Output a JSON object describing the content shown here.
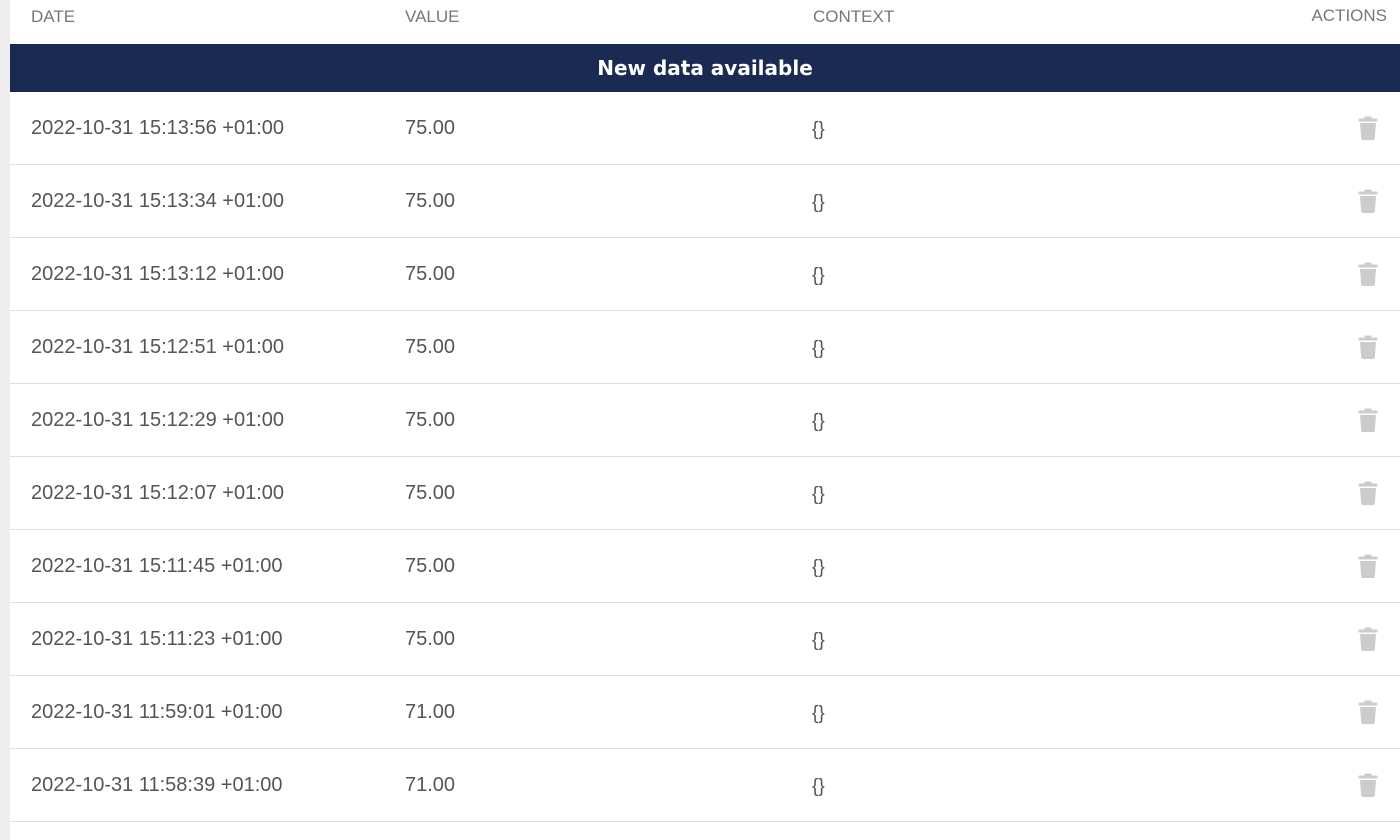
{
  "table": {
    "headers": {
      "date": "DATE",
      "value": "VALUE",
      "context": "CONTEXT",
      "actions": "ACTIONS"
    },
    "banner": "New data available",
    "rows": [
      {
        "date": "2022-10-31 15:13:56 +01:00",
        "value": "75.00",
        "context": "{}"
      },
      {
        "date": "2022-10-31 15:13:34 +01:00",
        "value": "75.00",
        "context": "{}"
      },
      {
        "date": "2022-10-31 15:13:12 +01:00",
        "value": "75.00",
        "context": "{}"
      },
      {
        "date": "2022-10-31 15:12:51 +01:00",
        "value": "75.00",
        "context": "{}"
      },
      {
        "date": "2022-10-31 15:12:29 +01:00",
        "value": "75.00",
        "context": "{}"
      },
      {
        "date": "2022-10-31 15:12:07 +01:00",
        "value": "75.00",
        "context": "{}"
      },
      {
        "date": "2022-10-31 15:11:45 +01:00",
        "value": "75.00",
        "context": "{}"
      },
      {
        "date": "2022-10-31 15:11:23 +01:00",
        "value": "75.00",
        "context": "{}"
      },
      {
        "date": "2022-10-31 11:59:01 +01:00",
        "value": "71.00",
        "context": "{}"
      },
      {
        "date": "2022-10-31 11:58:39 +01:00",
        "value": "71.00",
        "context": "{}"
      }
    ],
    "row_action_icon": "trash-icon"
  },
  "colors": {
    "banner_bg": "#1a2a52",
    "header_text": "#777777",
    "row_text": "#555555",
    "icon": "#cccccc"
  }
}
